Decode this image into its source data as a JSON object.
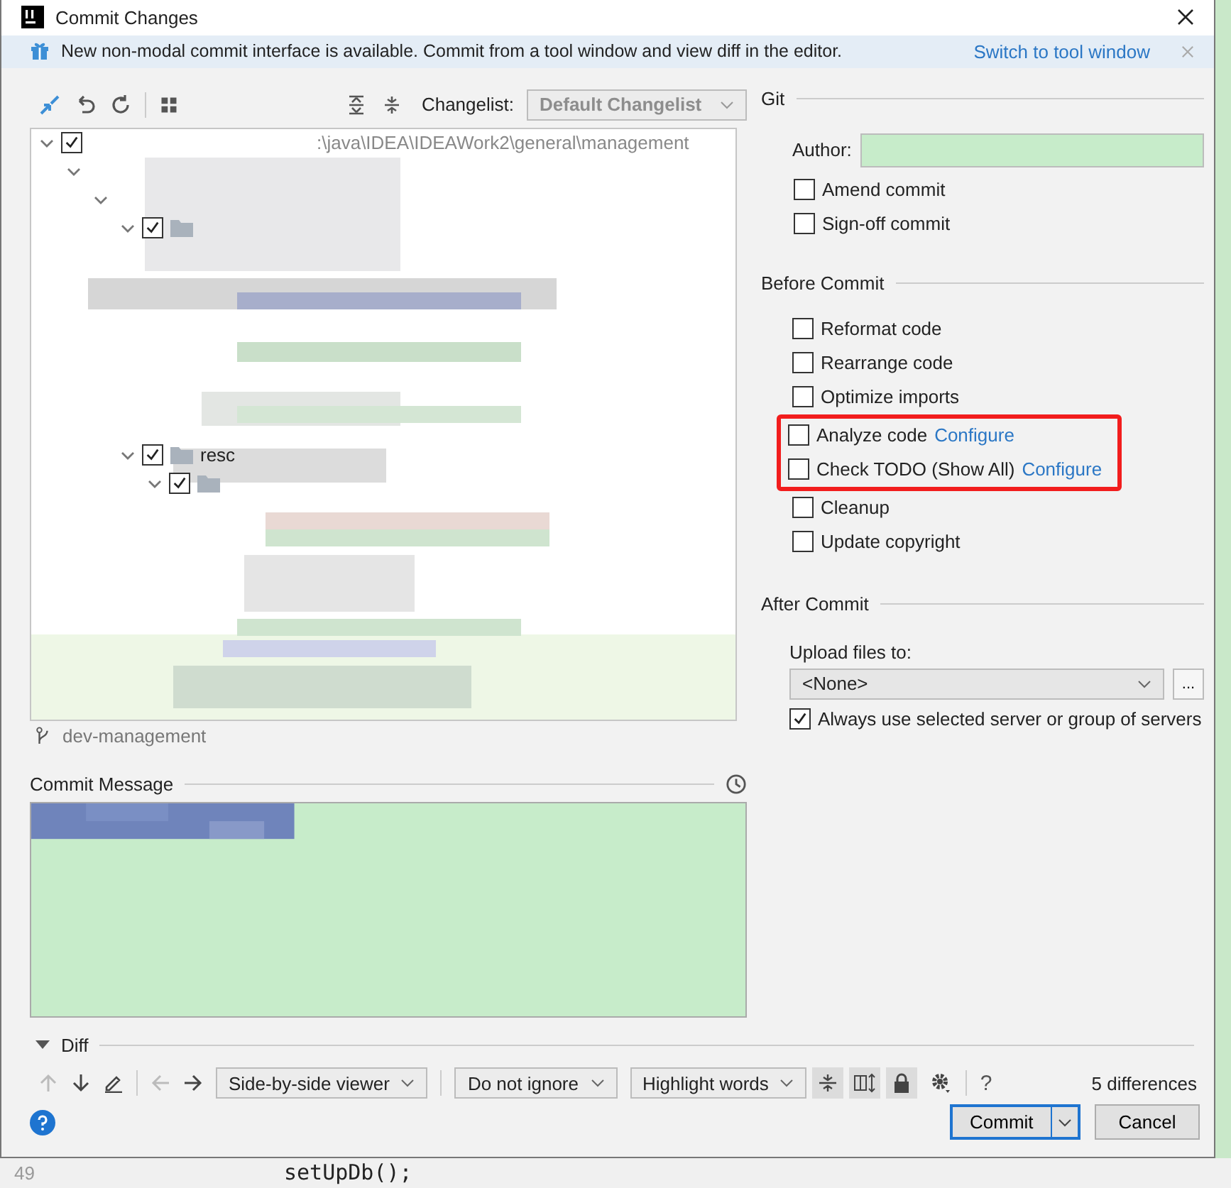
{
  "window": {
    "title": "Commit Changes"
  },
  "banner": {
    "text": "New non-modal commit interface is available. Commit from a tool window and view diff in the editor.",
    "link": "Switch to tool window"
  },
  "changes_toolbar": {
    "changelist_label": "Changelist:",
    "changelist_value": "Default Changelist"
  },
  "tree": [
    {
      "checked": true,
      "expanded": true,
      "label": ":\\java\\IDEA\\IDEAWork2\\general\\management",
      "children": [
        {
          "expanded": true,
          "children": [
            {
              "expanded": true,
              "children": [
                {
                  "checked": true,
                  "expanded": true,
                  "kind": "folder"
                },
                {
                  "checked": true,
                  "expanded": true,
                  "kind": "folder",
                  "label": "resc",
                  "children": [
                    {
                      "checked": true,
                      "expanded": true,
                      "kind": "folder"
                    }
                  ]
                }
              ]
            }
          ]
        }
      ]
    }
  ],
  "status_bar": {
    "branch": "dev-management"
  },
  "commit_message": {
    "label": "Commit Message"
  },
  "git": {
    "title": "Git",
    "author_label": "Author:",
    "options": [
      {
        "label": "Amend commit",
        "checked": false
      },
      {
        "label": "Sign-off commit",
        "checked": false
      }
    ]
  },
  "before_commit": {
    "title": "Before Commit",
    "options": [
      {
        "label": "Reformat code",
        "checked": false,
        "highlighted": false
      },
      {
        "label": "Rearrange code",
        "checked": false,
        "highlighted": false
      },
      {
        "label": "Optimize imports",
        "checked": false,
        "highlighted": false
      },
      {
        "label": "Analyze code",
        "link": "Configure",
        "checked": false,
        "highlighted": true
      },
      {
        "label": "Check TODO (Show All)",
        "link": "Configure",
        "checked": false,
        "highlighted": true
      },
      {
        "label": "Cleanup",
        "checked": false,
        "highlighted": false
      },
      {
        "label": "Update copyright",
        "checked": false,
        "highlighted": false
      }
    ]
  },
  "after_commit": {
    "title": "After Commit",
    "upload_label": "Upload files to:",
    "upload_value": "<None>",
    "more_button": "...",
    "always": {
      "label": "Always use selected server or group of servers",
      "checked": true
    }
  },
  "diff": {
    "title": "Diff",
    "expanded": true,
    "viewer": "Side-by-side viewer",
    "ignore": "Do not ignore",
    "highlight": "Highlight words",
    "help": "?",
    "count": "5 differences"
  },
  "buttons": [
    {
      "label": "Commit",
      "kind": "primary"
    },
    {
      "label": "Cancel",
      "kind": "normal"
    }
  ],
  "editor_behind": {
    "line_number": "49",
    "code": "setUpDb();"
  }
}
